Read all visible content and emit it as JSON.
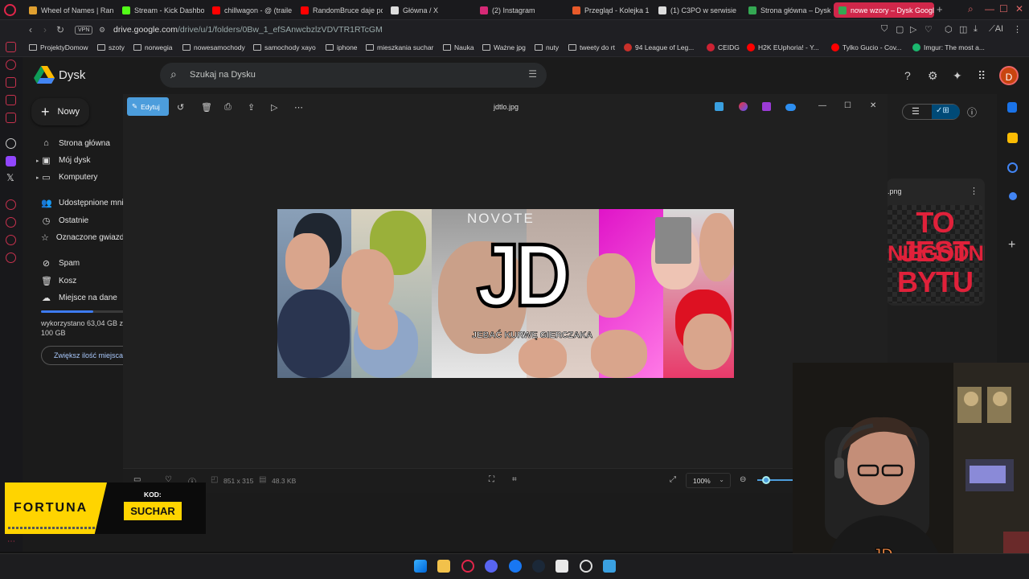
{
  "browser": {
    "tabs": [
      {
        "label": "Wheel of Names | Ran",
        "color": "#e0a030"
      },
      {
        "label": "Stream - Kick Dashbo",
        "color": "#53fc18"
      },
      {
        "label": "chillwagon - @ (traile",
        "color": "#ff0000"
      },
      {
        "label": "RandomBruce daje pc",
        "color": "#ff0000"
      },
      {
        "label": "Główna / X",
        "color": "#dddddd"
      },
      {
        "label": "(2) Instagram",
        "color": "#d62976"
      },
      {
        "label": "Przegląd - Kolejka 1 1",
        "color": "#e85a2a"
      },
      {
        "label": "(1) C3PO w serwisie",
        "color": "#dddddd"
      },
      {
        "label": "Strona główna – Dysk",
        "color": "#34a853"
      },
      {
        "label": "nowe wzory – Dysk Googl",
        "color": "#34a853"
      }
    ],
    "url_host": "drive.google.com",
    "url_path": "/drive/u/1/folders/0Bw_1_efSAnwcbzlzVDVTR1RTcGM",
    "vpn": "VPN",
    "ai": "AI",
    "bookmarks": [
      {
        "label": "ProjektyDomow",
        "type": "folder"
      },
      {
        "label": "szoty",
        "type": "folder"
      },
      {
        "label": "norwegia",
        "type": "folder"
      },
      {
        "label": "nowesamochody",
        "type": "folder"
      },
      {
        "label": "samochody xayo",
        "type": "folder"
      },
      {
        "label": "iphone",
        "type": "folder"
      },
      {
        "label": "mieszkania suchar",
        "type": "folder"
      },
      {
        "label": "Nauka",
        "type": "folder"
      },
      {
        "label": "Ważne jpg",
        "type": "folder"
      },
      {
        "label": "nuty",
        "type": "folder"
      },
      {
        "label": "tweety do rt",
        "type": "folder"
      },
      {
        "label": "94 League of Leg...",
        "type": "site",
        "color": "#c8302a"
      },
      {
        "label": "CEIDG",
        "type": "site",
        "color": "#cc2233"
      },
      {
        "label": "H2K EUphoria! - Y...",
        "type": "site",
        "color": "#ff0000"
      },
      {
        "label": "Tylko Gucio - Cov...",
        "type": "site",
        "color": "#ff0000"
      },
      {
        "label": "Imgur: The most a...",
        "type": "site",
        "color": "#1bb76e"
      }
    ]
  },
  "drive": {
    "app_name": "Dysk",
    "search_placeholder": "Szukaj na Dysku",
    "avatar_letter": "D",
    "new_button": "Nowy",
    "nav": [
      {
        "label": "Strona główna",
        "icon": "home-icon"
      },
      {
        "label": "Mój dysk",
        "icon": "my-drive-icon"
      },
      {
        "label": "Komputery",
        "icon": "computer-icon"
      },
      {
        "label": "Udostępnione mnie",
        "icon": "shared-icon"
      },
      {
        "label": "Ostatnie",
        "icon": "clock-icon"
      },
      {
        "label": "Oznaczone gwiazdką",
        "icon": "star-icon"
      },
      {
        "label": "Spam",
        "icon": "spam-icon"
      },
      {
        "label": "Kosz",
        "icon": "trash-icon"
      },
      {
        "label": "Miejsce na dane",
        "icon": "cloud-icon"
      }
    ],
    "storage_used": 0.63,
    "storage_line1": "wykorzystano 63,04 GB z",
    "storage_line2": "100 GB",
    "more_storage": "Zwiększ ilość miejsca",
    "file_card_name": ".png",
    "file_card_text": [
      "TO JEST",
      "NIEGODNE",
      "BYTU"
    ]
  },
  "viewer": {
    "edit_label": "Edytuj",
    "file_name": "jdtlo.jpg",
    "dimensions": "851 x 315",
    "size": "48.3 KB",
    "zoom": "100%",
    "zoom_level": 0.25,
    "image_title": "JD",
    "image_subtitle": "JEBAĆ KURWĘ GIERCZAKA",
    "image_sign": "NOVOTE"
  },
  "overlay": {
    "brand": "FORTUNA",
    "code_label": "KOD:",
    "code": "SUCHAR"
  }
}
